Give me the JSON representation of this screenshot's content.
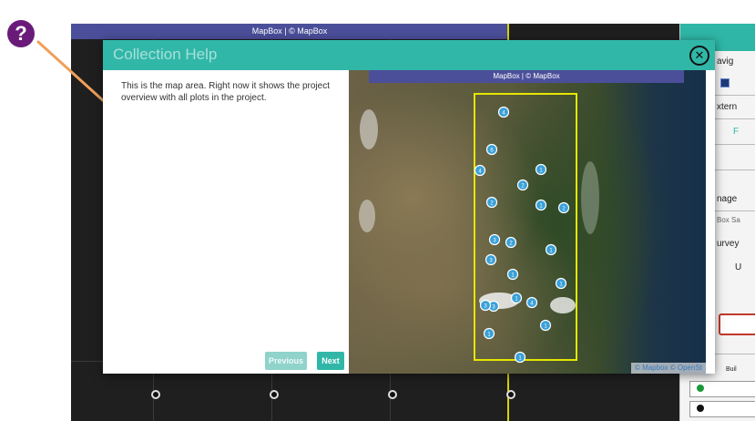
{
  "background_map": {
    "banner_text": "MapBox | © MapBox"
  },
  "side_panel": {
    "labels": [
      "avig",
      "xtern",
      "F",
      "nage",
      "Box Sa",
      "urvey",
      "U",
      "Buil"
    ]
  },
  "help_badge": {
    "symbol": "?",
    "arrow_color": "#f0a05a"
  },
  "modal": {
    "title": "Collection Help",
    "close_symbol": "✕",
    "text": "This is the map area. Right now it shows the project overview with all plots in the project.",
    "prev_label": "Previous",
    "next_label": "Next",
    "map_banner": "MapBox | © MapBox",
    "map_attr": "© Mapbox © OpenSt",
    "plot_markers": [
      {
        "label": "4"
      },
      {
        "label": "6"
      },
      {
        "label": "4"
      },
      {
        "label": "1"
      },
      {
        "label": "2"
      },
      {
        "label": "2"
      },
      {
        "label": "1"
      },
      {
        "label": "2"
      },
      {
        "label": "3"
      },
      {
        "label": "2"
      },
      {
        "label": "1"
      },
      {
        "label": "3"
      },
      {
        "label": "1"
      },
      {
        "label": "1"
      },
      {
        "label": "3"
      },
      {
        "label": "1"
      },
      {
        "label": "4"
      },
      {
        "label": "3"
      },
      {
        "label": "1"
      },
      {
        "label": "1"
      },
      {
        "label": "1"
      }
    ]
  },
  "colors": {
    "teal_accent": "#31b7a8",
    "mapbox_banner": "#4b4f9a",
    "study_area_outline": "#e6e600",
    "marker": "#3aa0d8",
    "badge": "#6a1b7a"
  }
}
